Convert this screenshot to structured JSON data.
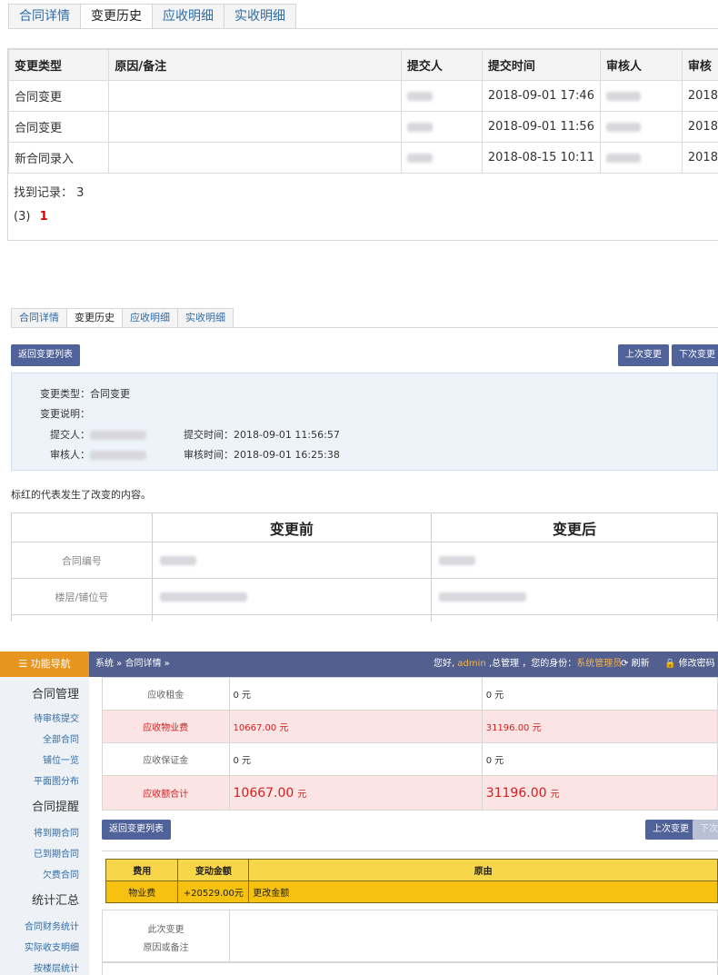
{
  "panel1": {
    "tabs": [
      "合同详情",
      "变更历史",
      "应收明细",
      "实收明细"
    ],
    "headers": [
      "变更类型",
      "原因/备注",
      "提交人",
      "提交时间",
      "审核人",
      "审核"
    ],
    "rows": [
      {
        "type": "合同变更",
        "remark": "",
        "time": "2018-09-01 17:46",
        "aud_time": "2018"
      },
      {
        "type": "合同变更",
        "remark": "",
        "time": "2018-09-01 11:56",
        "aud_time": "2018"
      },
      {
        "type": "新合同录入",
        "remark": "",
        "time": "2018-08-15 10:11",
        "aud_time": "2018"
      }
    ],
    "found": "找到记录： 3",
    "pager_total": "(3)",
    "pager_current": "1"
  },
  "panel2": {
    "tabs": [
      "合同详情",
      "变更历史",
      "应收明细",
      "实收明细"
    ],
    "back_button": "返回变更列表",
    "prev_button": "上次变更",
    "next_button": "下次变更",
    "type_line": "变更类型：合同变更",
    "desc_line": "变更说明：",
    "submitter_label": "提交人：",
    "submit_time": "提交时间：2018-09-01 11:56:57",
    "auditor_label": "审核人：",
    "audit_time": "审核时间：2018-09-01 16:25:38",
    "note": "标红的代表发生了改变的内容。",
    "col_before": "变更前",
    "col_after": "变更后",
    "rows": [
      "合同编号",
      "楼层/铺位号"
    ]
  },
  "panel3": {
    "nav_button": "☰ 功能导航",
    "breadcrumb": "系统 » 合同详情 »",
    "greeting": "您好, ",
    "username": "admin",
    "role_sep": " ,总管理 ，您的身份：",
    "identity": "系统管理员",
    "refresh": "刷新",
    "change_pwd": "修改密码",
    "sidebar": [
      {
        "header": "合同管理",
        "items": [
          "待审核提交",
          "全部合同",
          "铺位一览",
          "平面图分布"
        ]
      },
      {
        "header": "合同提醒",
        "items": [
          "将到期合同",
          "已到期合同",
          "欠费合同"
        ]
      },
      {
        "header": "统计汇总",
        "items": [
          "合同财务统计",
          "实际收支明细",
          "按楼层统计"
        ]
      }
    ],
    "fee_rows": [
      {
        "label": "应收租金",
        "before": "0 元",
        "after": "0 元",
        "changed": false
      },
      {
        "label": "应收物业费",
        "before": "10667.00 元",
        "after": "31196.00 元",
        "changed": true
      },
      {
        "label": "应收保证金",
        "before": "0 元",
        "after": "0 元",
        "changed": false
      }
    ],
    "total": {
      "label": "应收额合计",
      "before": "10667.00",
      "after": "31196.00",
      "unit": "元"
    },
    "back_button": "返回变更列表",
    "prev_button": "上次变更",
    "next_button": "下次变更",
    "reason_headers": [
      "费用",
      "变动金额",
      "原由"
    ],
    "reason_row": {
      "fee": "物业费",
      "amount": "+20529.00元",
      "reason": "更改金额"
    },
    "change_label_1": "此次变更",
    "change_label_2": "原因或备注",
    "colors": {
      "topbar": "#53608f",
      "nav": "#e8951f",
      "highlight": "#fde4e4",
      "reason": "#f6c20f"
    }
  }
}
